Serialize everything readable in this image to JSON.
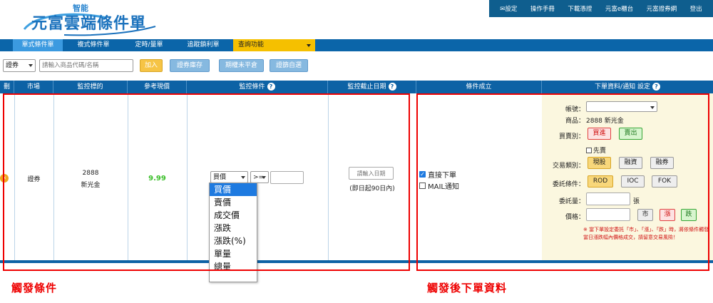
{
  "logo": {
    "small": "智能",
    "main": "元富雲端條件單"
  },
  "top_nav": [
    "✉設定",
    "操作手冊",
    "下載憑證",
    "元富e櫃台",
    "元富證券網",
    "登出"
  ],
  "tabs": [
    "單式條件單",
    "複式條件單",
    "定時/量單",
    "追蹤鎖利單"
  ],
  "query_menu": "查詢功能",
  "toolbar": {
    "type_select": "證券",
    "search_placeholder": "請輸入商品代碼/名稱",
    "add_button": "加入",
    "btn_inventory": "證券庫存",
    "btn_futures": "期權未平倉",
    "btn_self_select": "證篩自選"
  },
  "table_headers": {
    "del": "刪",
    "market": "市場",
    "target": "監控標的",
    "ref_price": "參考現價",
    "condition": "監控條件",
    "deadline": "監控截止日期",
    "triggered": "條件成立",
    "order_info": "下單資料/通知 設定"
  },
  "row": {
    "market": "證券",
    "code": "2888",
    "name": "新光金",
    "ref_price": "9.99",
    "condition_field": "買價",
    "condition_op": ">=",
    "date_placeholder": "請輸入日期",
    "date_note": "(即日起90日內)",
    "direct_order": "直接下單",
    "mail_notify": "MAIL通知"
  },
  "condition_options": [
    "買價",
    "賣價",
    "成交價",
    "漲跌",
    "漲跌(%)",
    "單量",
    "總量"
  ],
  "order_panel": {
    "account_label": "帳號：",
    "product_label": "商品：",
    "product_value": "2888 新光金",
    "side_label": "買賣別：",
    "buy": "買進",
    "sell": "賣出",
    "first_sell": "先賣",
    "trade_type_label": "交易類別：",
    "trade_types": [
      "現股",
      "融資",
      "融券"
    ],
    "order_cond_label": "委託條件：",
    "order_conds": [
      "ROD",
      "IOC",
      "FOK"
    ],
    "qty_label": "委託量：",
    "qty_unit": "張",
    "price_label": "價格：",
    "price_buttons": [
      "市",
      "漲",
      "跌"
    ],
    "note": "※ 當下單設定委託「市」、「漲」、「跌」時，將依條件觸發當日漲跌幅內價格成交，請留意交易風險！"
  },
  "annotations": {
    "left": "觸發條件",
    "right": "觸發後下單資料"
  },
  "colors": {
    "brand_blue": "#0d62a5",
    "highlight_red": "#e00000",
    "accent_yellow": "#f5c000",
    "price_green": "#3bbf2a"
  }
}
